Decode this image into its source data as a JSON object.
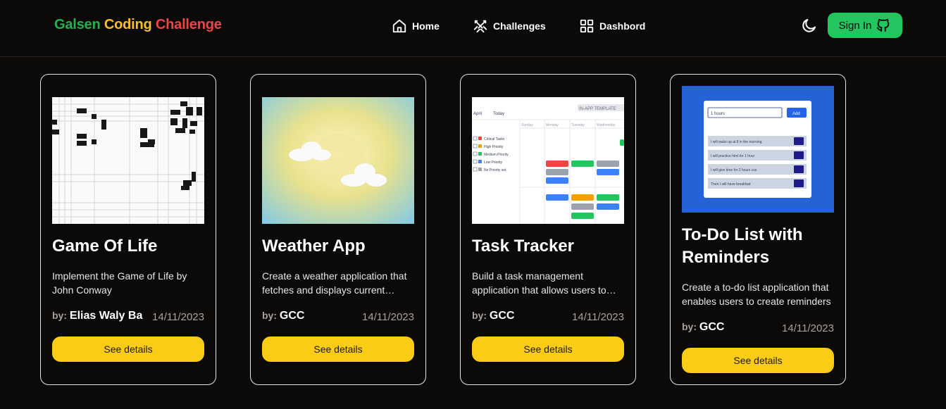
{
  "brand": {
    "part1": "Galsen",
    "part2": "Coding",
    "part3": "Challenge"
  },
  "nav": {
    "home": "Home",
    "challenges": "Challenges",
    "dashboard": "Dashbord"
  },
  "auth": {
    "signin_label": "Sign In"
  },
  "icons": {
    "home": "home-icon",
    "challenges": "crossed-swords-icon",
    "dashboard": "dashboard-grid-icon",
    "theme": "moon-icon",
    "github": "github-icon"
  },
  "colors": {
    "background": "#0b0a09",
    "brand_green": "#22b14c",
    "brand_yellow": "#fbbf24",
    "brand_red": "#ef4444",
    "signin_green": "#22c55e",
    "button_yellow": "#facc15"
  },
  "cards": [
    {
      "title": "Game Of Life",
      "description": "Implement the Game of Life by John Conway",
      "by_label": "by:",
      "author": "Elias Waly Ba",
      "date": "14/11/2023",
      "button": "See details"
    },
    {
      "title": "Weather App",
      "description": "Create a weather application that fetches and displays current weather data",
      "by_label": "by:",
      "author": "GCC",
      "date": "14/11/2023",
      "button": "See details"
    },
    {
      "title": "Task Tracker",
      "description": "Build a task management application that allows users to track tasks",
      "by_label": "by:",
      "author": "GCC",
      "date": "14/11/2023",
      "button": "See details"
    },
    {
      "title": "To-Do List with Reminders",
      "description": "Create a to-do list application that enables users to create reminders",
      "by_label": "by:",
      "author": "GCC",
      "date": "14/11/2023",
      "button": "See details"
    }
  ],
  "todo_preview": {
    "input_value": "1 hours",
    "add_label": "Add",
    "items": [
      "I will wake up at 8 in the morning",
      "I will practice html for 1 hour",
      "I will give time for 2 hours css",
      "Then I will have breakfast"
    ]
  },
  "task_preview": {
    "filter_month": "April",
    "filter_view": "Today",
    "template_label": "IN-APP TEMPLATE",
    "legend": [
      "Critical Tasks",
      "High Priority",
      "Medium Priority",
      "Low Priority",
      "No Priority set"
    ],
    "days": [
      "Sunday",
      "Monday",
      "Tuesday",
      "Wednesday"
    ]
  }
}
